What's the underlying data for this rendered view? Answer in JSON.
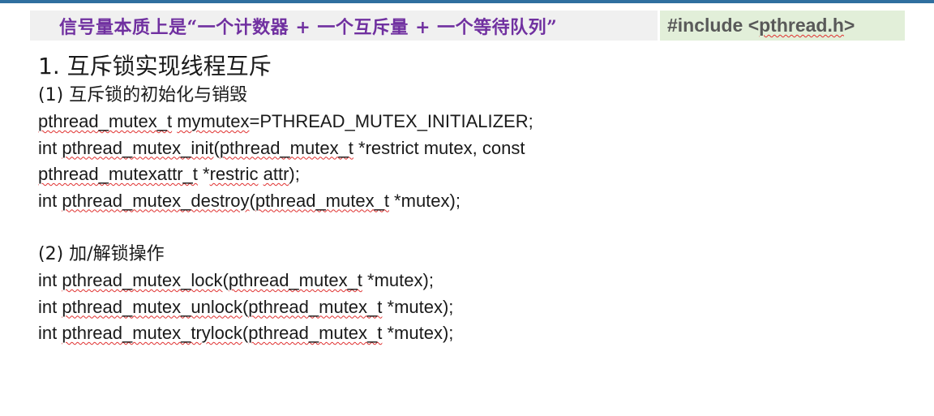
{
  "header": {
    "title": "信号量本质上是“一个计数器 + 一个互斥量 + 一个等待队列”",
    "include": {
      "prefix": "#include <",
      "word": "pthread.h",
      "suffix": ">"
    }
  },
  "section1": {
    "heading": "1. 互斥锁实现线程互斥",
    "sub1": "(1) 互斥锁的初始化与销毁",
    "l1": {
      "a": "pthread_mutex_t",
      "b": " ",
      "c": "mymutex",
      "d": "=PTHREAD_MUTEX_INITIALIZER;"
    },
    "l2": {
      "a": "int ",
      "b": "pthread_mutex_init",
      "c": "(",
      "d": "pthread_mutex_t",
      "e": " *restrict mutex, const"
    },
    "l3": {
      "a": "pthread_mutexattr_t",
      "b": " *",
      "c": "restric",
      "d": " ",
      "e": "attr",
      "f": ");"
    },
    "l4": {
      "a": "int ",
      "b": "pthread_mutex_destroy",
      "c": "(",
      "d": "pthread_mutex_t",
      "e": " *mutex);"
    },
    "sub2": "(2) 加/解锁操作",
    "l5": {
      "a": "int ",
      "b": "pthread_mutex_lock",
      "c": "(",
      "d": "pthread_mutex_t",
      "e": " *mutex);"
    },
    "l6": {
      "a": "int ",
      "b": "pthread_mutex_unlock",
      "c": "(",
      "d": "pthread_mutex_t",
      "e": " *mutex);"
    },
    "l7": {
      "a": "int ",
      "b": "pthread_mutex_trylock",
      "c": "(",
      "d": "pthread_mutex_t",
      "e": " *mutex);"
    }
  }
}
